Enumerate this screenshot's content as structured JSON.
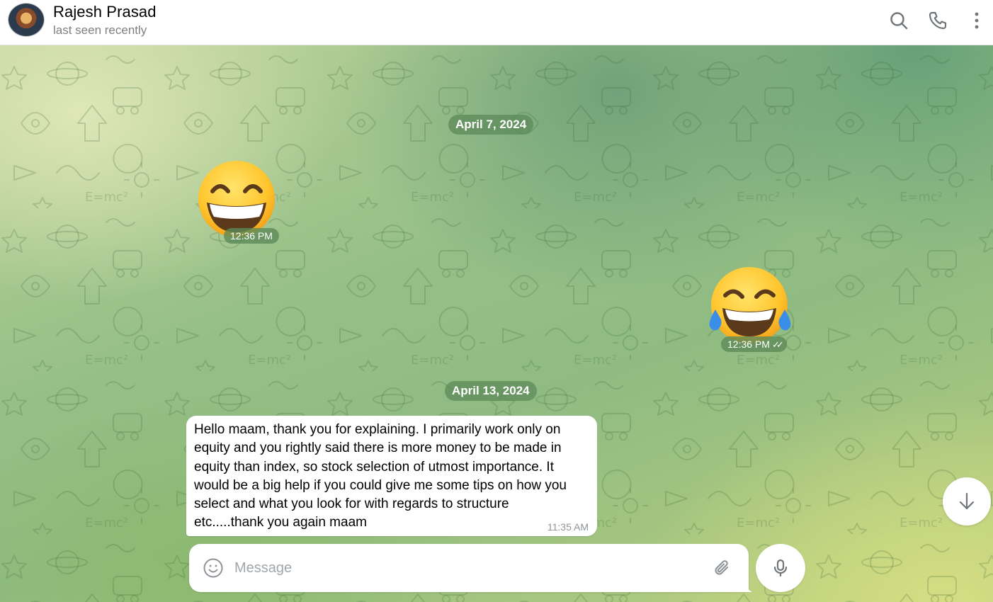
{
  "header": {
    "contact_name": "Rajesh Prasad",
    "contact_status": "last seen recently",
    "icons": [
      "search-icon",
      "phone-icon",
      "more-vertical-icon"
    ]
  },
  "messages": {
    "date_1": "April 7, 2024",
    "sticker_1": {
      "emoji": "grinning-face-with-smiling-eyes",
      "time": "12:36 PM",
      "direction": "incoming"
    },
    "sticker_2": {
      "emoji": "face-with-tears-of-joy",
      "time": "12:36 PM",
      "direction": "outgoing",
      "status": "read"
    },
    "date_2": "April 13, 2024",
    "text_message": {
      "text": "Hello maam, thank you for explaining.  I primarily work only on\nequity and you rightly said there is more money to be made in\nequity than index, so stock selection of utmost importance.  It\nwould be a big help if you could give me some tips on how you\nselect and what you look for with regards to structure\netc.....thank you again maam",
      "time": "11:35 AM",
      "direction": "incoming"
    }
  },
  "composer": {
    "placeholder": "Message",
    "value": ""
  },
  "colors": {
    "header_bg": "#ffffff",
    "pill_bg": "#5c8a58",
    "bubble_bg": "#ffffff"
  }
}
